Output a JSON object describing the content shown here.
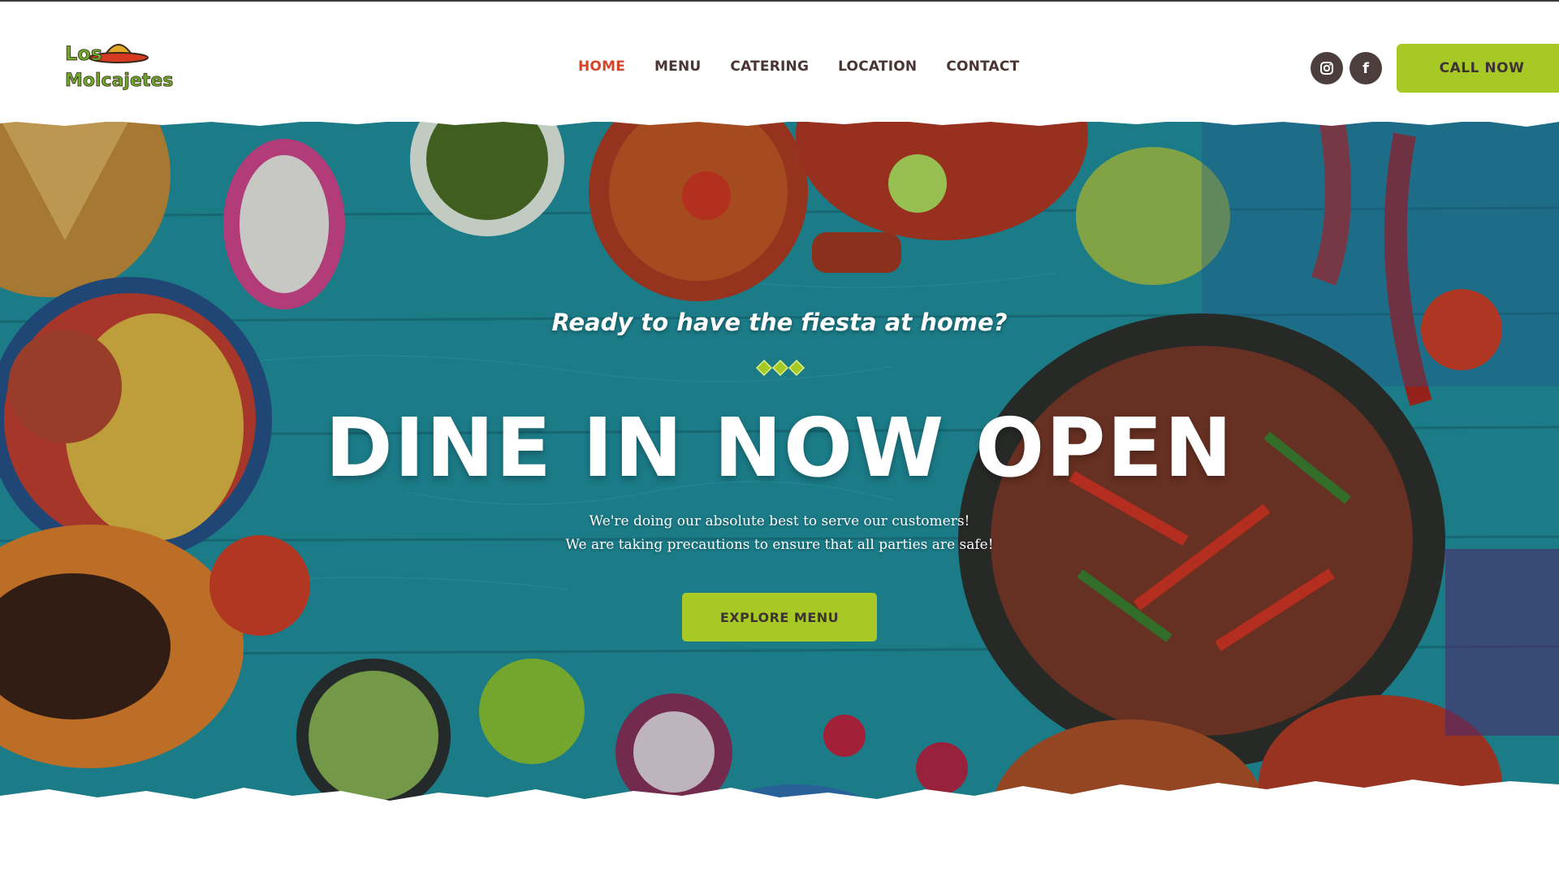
{
  "brand": {
    "logo_line1": "Los",
    "logo_line2": "Molcajetes"
  },
  "nav": {
    "items": [
      {
        "label": "HOME",
        "active": true
      },
      {
        "label": "MENU",
        "active": false
      },
      {
        "label": "CATERING",
        "active": false
      },
      {
        "label": "LOCATION",
        "active": false
      },
      {
        "label": "CONTACT",
        "active": false
      }
    ]
  },
  "socials": {
    "instagram_glyph": "◎",
    "facebook_glyph": "f"
  },
  "header": {
    "call_label": "CALL NOW"
  },
  "hero": {
    "tagline": "Ready to have the fiesta at home?",
    "headline": "DINE IN NOW OPEN",
    "sub_line1": "We're doing our absolute best to serve our customers!",
    "sub_line2": "We are taking precautions to ensure that all parties are safe!",
    "cta_label": "EXPLORE MENU"
  },
  "colors": {
    "accent": "#a6c925",
    "nav_active": "#d4462a",
    "nav_text": "#4a3535",
    "hero_bg": "#1d8a96"
  }
}
